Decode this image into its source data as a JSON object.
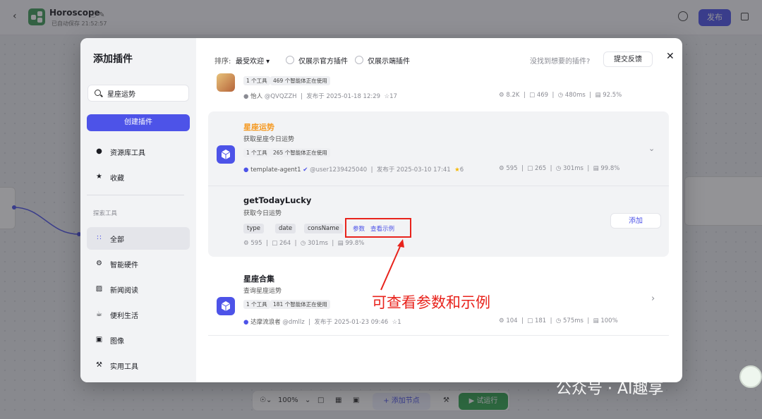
{
  "app": {
    "title": "Horoscope",
    "saved_status": "已自动保存 21:52:57",
    "publish_label": "发布"
  },
  "bottombar": {
    "zoom": "100%",
    "add_node": "添加节点",
    "test_run": "试运行"
  },
  "modal": {
    "title": "添加插件",
    "search_value": "星座运势",
    "create_label": "创建插件",
    "nav_top": [
      {
        "label": "资源库工具",
        "icon": "user-icon"
      },
      {
        "label": "收藏",
        "icon": "star-icon"
      }
    ],
    "section_label": "探索工具",
    "nav_categories": [
      {
        "label": "全部",
        "icon": "grid-icon",
        "active": true
      },
      {
        "label": "智能硬件",
        "icon": "chip-icon"
      },
      {
        "label": "新闻阅读",
        "icon": "book-icon"
      },
      {
        "label": "便利生活",
        "icon": "cup-icon"
      },
      {
        "label": "图像",
        "icon": "image-icon"
      },
      {
        "label": "实用工具",
        "icon": "wrench-icon"
      }
    ],
    "filter": {
      "sort_label": "排序:",
      "sort_value": "最受欢迎",
      "official_only": "仅展示官方插件",
      "device_only": "仅展示端插件",
      "not_found": "没找到想要的插件?",
      "feedback": "提交反馈"
    },
    "plugins": [
      {
        "tools_tag": "1 个工具",
        "users_tag": "469 个智能体正在使用",
        "author": "怡人",
        "handle": "@QVQZZH",
        "published": "发布于 2025-01-18 12:29",
        "stars": "17",
        "stats": {
          "calls": "8.2K",
          "bots": "469",
          "latency": "480ms",
          "success": "92.5%"
        }
      },
      {
        "name": "星座运势",
        "desc": "获取星座今日运势",
        "tools_tag": "1 个工具",
        "users_tag": "265 个智能体正在使用",
        "author": "template-agent1",
        "handle": "@user1239425040",
        "published": "发布于 2025-03-10 17:41",
        "stars": "6",
        "stats": {
          "calls": "595",
          "bots": "265",
          "latency": "301ms",
          "success": "99.8%"
        },
        "tool": {
          "name": "getTodayLucky",
          "desc": "获取今日运势",
          "params": [
            "type",
            "date",
            "consName"
          ],
          "params_link": "参数",
          "example_link": "查看示例",
          "add_label": "添加",
          "stats": {
            "calls": "595",
            "bots": "264",
            "latency": "301ms",
            "success": "99.8%"
          }
        }
      },
      {
        "name": "星座合集",
        "desc": "查询星座运势",
        "tools_tag": "1 个工具",
        "users_tag": "181 个智能体正在使用",
        "author": "达摩流浪者",
        "handle": "@dmllz",
        "published": "发布于 2025-01-23 09:46",
        "stars": "1",
        "stats": {
          "calls": "104",
          "bots": "181",
          "latency": "575ms",
          "success": "100%"
        }
      }
    ]
  },
  "annotation": {
    "text": "可查看参数和示例",
    "color": "#e8231c"
  },
  "watermark": "公众号 · AI趣享",
  "colors": {
    "accent": "#4d53e8",
    "run": "#32a650",
    "plugin_name_highlight": "#f59a23"
  }
}
